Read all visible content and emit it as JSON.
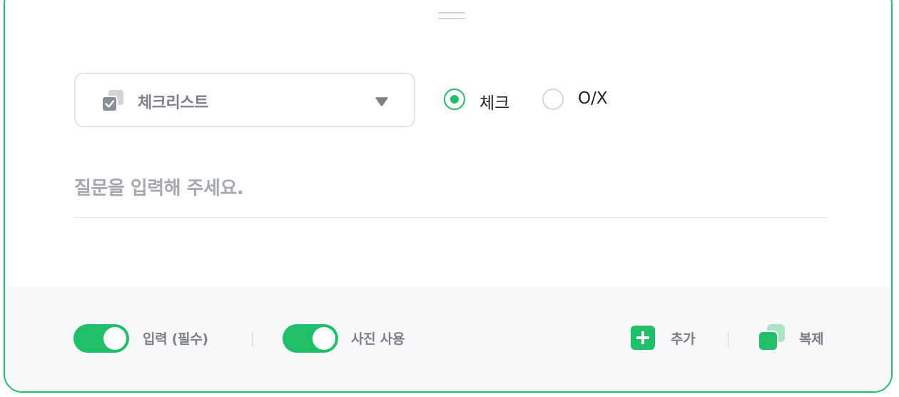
{
  "question_type": {
    "selected_label": "체크리스트",
    "icon": "checklist-icon"
  },
  "answer_style": {
    "options": [
      {
        "label": "체크",
        "checked": true
      },
      {
        "label": "O/X",
        "checked": false
      }
    ]
  },
  "question": {
    "placeholder": "질문을 입력해 주세요.",
    "value": ""
  },
  "footer": {
    "required_toggle": {
      "label": "입력 (필수)",
      "on": true
    },
    "photo_toggle": {
      "label": "사진 사용",
      "on": true
    },
    "add_label": "추가",
    "copy_label": "복제"
  },
  "colors": {
    "accent": "#1fbf6a",
    "accent_light": "#a8e6c4",
    "muted_text": "#7d808a",
    "placeholder": "#a5a8ae",
    "footer_bg": "#f7f8f9"
  }
}
